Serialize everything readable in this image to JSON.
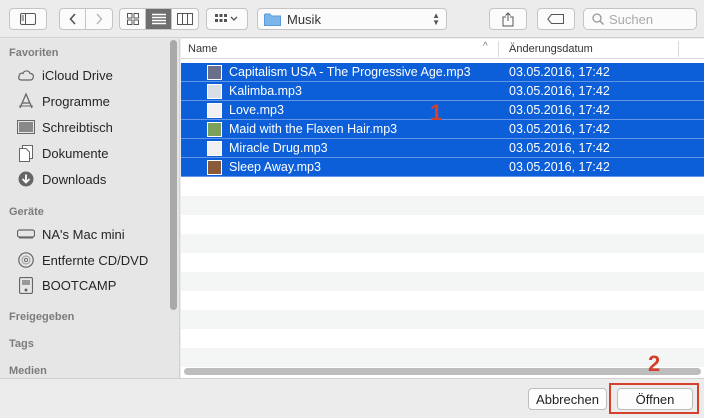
{
  "toolbar": {
    "path": {
      "label": "Musik"
    },
    "search": {
      "placeholder": "Suchen"
    }
  },
  "sidebar": {
    "sections": [
      {
        "title": "Favoriten",
        "items": [
          {
            "label": "iCloud Drive",
            "icon": "cloud-icon"
          },
          {
            "label": "Programme",
            "icon": "apps-icon"
          },
          {
            "label": "Schreibtisch",
            "icon": "desktop-icon"
          },
          {
            "label": "Dokumente",
            "icon": "document-icon"
          },
          {
            "label": "Downloads",
            "icon": "download-icon"
          }
        ]
      },
      {
        "title": "Geräte",
        "items": [
          {
            "label": "NA's Mac mini",
            "icon": "computer-icon"
          },
          {
            "label": "Entfernte CD/DVD",
            "icon": "disc-icon"
          },
          {
            "label": "BOOTCAMP",
            "icon": "drive-icon"
          }
        ]
      },
      {
        "title": "Freigegeben"
      },
      {
        "title": "Tags"
      },
      {
        "title": "Medien"
      }
    ]
  },
  "list": {
    "columns": {
      "name": "Name",
      "date": "Änderungsdatum"
    },
    "files": [
      {
        "name": "Capitalism USA - The Progressive Age.mp3",
        "date": "03.05.2016, 17:42",
        "selected": true,
        "thumb": "#6a6f8c"
      },
      {
        "name": "Kalimba.mp3",
        "date": "03.05.2016, 17:42",
        "selected": true,
        "thumb": "#d9dde6"
      },
      {
        "name": "Love.mp3",
        "date": "03.05.2016, 17:42",
        "selected": true,
        "thumb": "#f0f0f0"
      },
      {
        "name": "Maid with the Flaxen Hair.mp3",
        "date": "03.05.2016, 17:42",
        "selected": true,
        "thumb": "#7aa05a"
      },
      {
        "name": "Miracle Drug.mp3",
        "date": "03.05.2016, 17:42",
        "selected": true,
        "thumb": "#f0f0f0"
      },
      {
        "name": "Sleep Away.mp3",
        "date": "03.05.2016, 17:42",
        "selected": true,
        "thumb": "#8a5a3a"
      }
    ]
  },
  "annotations": {
    "step1": "1",
    "step2": "2"
  },
  "buttons": {
    "cancel": "Abbrechen",
    "open": "Öffnen"
  },
  "colors": {
    "selection": "#0c5fd8",
    "annotation": "#d4402c"
  }
}
